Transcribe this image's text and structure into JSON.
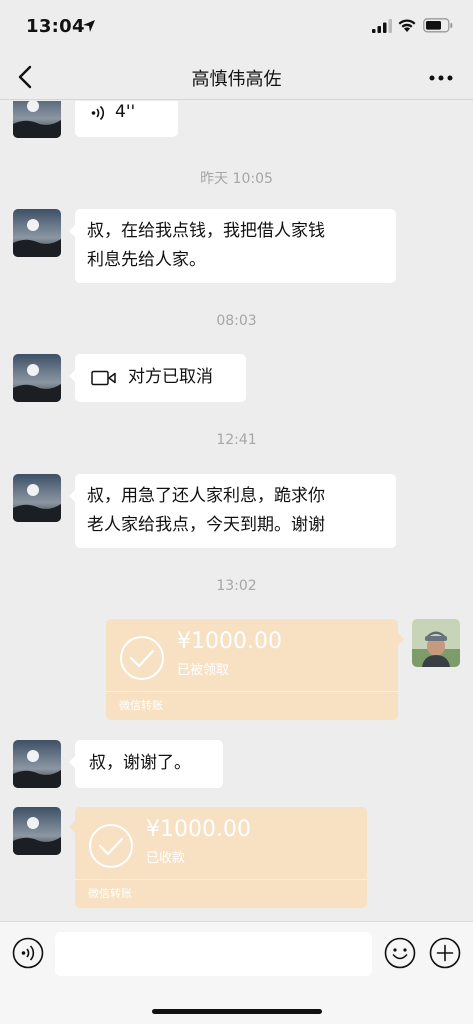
{
  "status_bar": {
    "time": "13:04"
  },
  "header": {
    "title": "高慎伟高佐"
  },
  "messages": {
    "voice_duration": "4''",
    "ts1": "昨天 10:05",
    "msg1_line1": "叔，在给我点钱，我把借人家钱",
    "msg1_line2": "利息先给人家。",
    "ts2": "08:03",
    "video_call_text": "对方已取消",
    "ts3": "12:41",
    "msg2_line1": "叔，用急了还人家利息，跪求你",
    "msg2_line2": "老人家给我点，今天到期。谢谢",
    "ts4": "13:02",
    "transfer1": {
      "amount": "¥1000.00",
      "status": "已被领取",
      "label": "微信转账"
    },
    "msg3": "叔，谢谢了。",
    "transfer2": {
      "amount": "¥1000.00",
      "status": "已收款",
      "label": "微信转账"
    }
  },
  "colors": {
    "background": "#ededed",
    "transfer_bubble": "#f8e1c2",
    "bubble": "#ffffff"
  }
}
